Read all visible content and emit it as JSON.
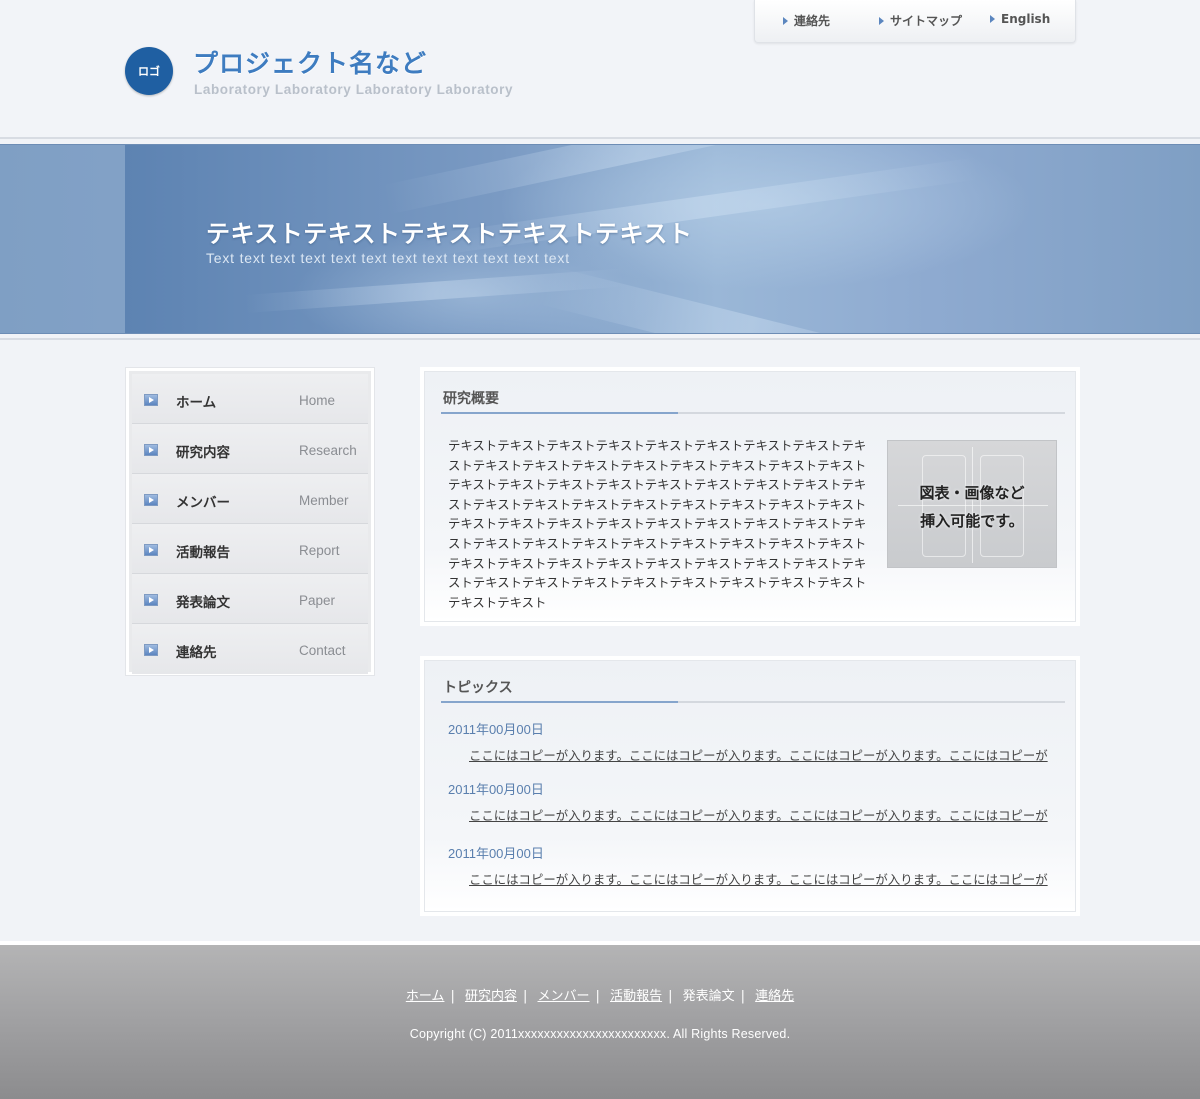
{
  "header": {
    "logo_text": "ロゴ",
    "title": "プロジェクト名など",
    "subtitle": "Laboratory Laboratory Laboratory Laboratory"
  },
  "util_nav": [
    {
      "label": "連絡先"
    },
    {
      "label": "サイトマップ"
    },
    {
      "label": "English"
    }
  ],
  "hero": {
    "title": "テキストテキストテキストテキストテキスト",
    "subtitle": "Text text text text text text text text text text text text"
  },
  "sidebar": {
    "items": [
      {
        "jp": "ホーム",
        "en": "Home"
      },
      {
        "jp": "研究内容",
        "en": "Research"
      },
      {
        "jp": "メンバー",
        "en": "Member"
      },
      {
        "jp": "活動報告",
        "en": "Report"
      },
      {
        "jp": "発表論文",
        "en": "Paper"
      },
      {
        "jp": "連絡先",
        "en": "Contact"
      }
    ]
  },
  "overview": {
    "heading": "研究概要",
    "body": "テキストテキストテキストテキストテキストテキストテキストテキストテキストテキストテキストテキストテキストテキストテキストテキストテキストテキストテキストテキストテキストテキストテキストテキストテキストテキストテキストテキストテキストテキストテキストテキストテキストテキストテキストテキストテキストテキストテキストテキストテキストテキストテキストテキストテキストテキストテキストテキストテキストテキストテキストテキストテキストテキストテキストテキストテキストテキストテキストテキストテキストテキストテキストテキストテキストテキストテキストテキストテキストテキスト",
    "figure_line1": "図表・画像など",
    "figure_line2": "挿入可能です。"
  },
  "topics": {
    "heading": "トピックス",
    "items": [
      {
        "date": "2011年00月00日",
        "text": "ここにはコピーが入ります。ここにはコピーが入ります。ここにはコピーが入ります。ここにはコピーが"
      },
      {
        "date": "2011年00月00日",
        "text": "ここにはコピーが入ります。ここにはコピーが入ります。ここにはコピーが入ります。ここにはコピーが"
      },
      {
        "date": "2011年00月00日",
        "text": "ここにはコピーが入ります。ここにはコピーが入ります。ここにはコピーが入ります。ここにはコピーが"
      }
    ]
  },
  "footer": {
    "links": [
      "ホーム",
      "研究内容",
      "メンバー",
      "活動報告",
      "発表論文",
      "連絡先"
    ],
    "copyright": "Copyright (C) 2011xxxxxxxxxxxxxxxxxxxxxxx. All Rights Reserved."
  }
}
